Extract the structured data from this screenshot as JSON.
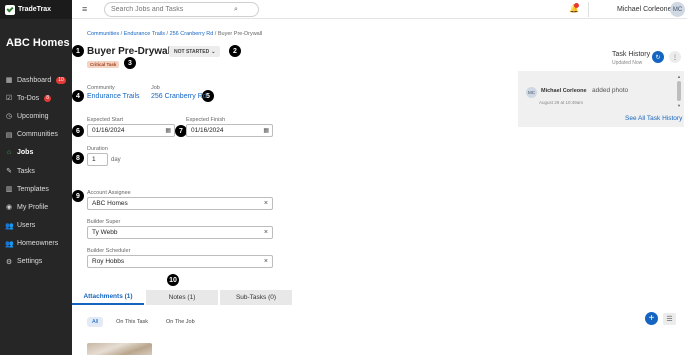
{
  "app": {
    "logo_text": "TradeTrax",
    "org_name": "ABC Homes"
  },
  "sidebar": {
    "items": [
      {
        "label": "Dashboard",
        "icon": "calendar-icon",
        "badge": "10"
      },
      {
        "label": "To-Dos",
        "icon": "checklist-icon",
        "badge": "8"
      },
      {
        "label": "Upcoming",
        "icon": "clock-icon",
        "badge": ""
      },
      {
        "label": "Communities",
        "icon": "map-icon",
        "badge": ""
      },
      {
        "label": "Jobs",
        "icon": "house-icon",
        "badge": "",
        "active": true
      },
      {
        "label": "Tasks",
        "icon": "wrench-icon",
        "badge": ""
      },
      {
        "label": "Templates",
        "icon": "template-icon",
        "badge": ""
      },
      {
        "label": "My Profile",
        "icon": "profile-icon",
        "badge": ""
      },
      {
        "label": "Users",
        "icon": "users-icon",
        "badge": ""
      },
      {
        "label": "Homeowners",
        "icon": "homeowners-icon",
        "badge": ""
      },
      {
        "label": "Settings",
        "icon": "gear-icon",
        "badge": ""
      }
    ]
  },
  "topbar": {
    "search_placeholder": "Search Jobs and Tasks",
    "user_name": "Michael Corleone",
    "avatar_initials": "MC"
  },
  "breadcrumb": {
    "items": [
      "Communities",
      "Endurance Trails",
      "256 Cranberry Rd",
      "Buyer Pre-Drywall"
    ],
    "separator": " / "
  },
  "task": {
    "title": "Buyer Pre-Drywall",
    "status": "NOT STARTED",
    "tag": "Critical Task",
    "community_label": "Community",
    "community_value": "Endurance Trails",
    "job_label": "Job",
    "job_value": "256 Cranberry Rd",
    "expected_start_label": "Expected Start",
    "expected_start_value": "01/16/2024",
    "expected_finish_label": "Expected Finish",
    "expected_finish_value": "01/16/2024",
    "duration_label": "Duration",
    "duration_value": "1",
    "duration_unit": "day",
    "account_assignee_label": "Account Assignee",
    "account_assignee_value": "ABC Homes",
    "builder_super_label": "Builder Super",
    "builder_super_value": "Ty Webb",
    "builder_scheduler_label": "Builder Scheduler",
    "builder_scheduler_value": "Roy Hobbs"
  },
  "markers": [
    "1",
    "2",
    "3",
    "4",
    "5",
    "6",
    "7",
    "8",
    "9",
    "10"
  ],
  "tabs": [
    {
      "label": "Attachments (1)",
      "active": true
    },
    {
      "label": "Notes (1)",
      "active": false
    },
    {
      "label": "Sub-Tasks (0)",
      "active": false
    }
  ],
  "filters": [
    {
      "label": "All",
      "active": true
    },
    {
      "label": "On This Task",
      "active": false
    },
    {
      "label": "On The Job",
      "active": false
    }
  ],
  "history": {
    "title": "Task History",
    "subtitle": "Updated Now",
    "entry_initials": "MC",
    "entry_name": "Michael Corleone",
    "entry_action": "added photo",
    "entry_time": "August 29 at 10:49am",
    "see_all": "See All Task History"
  },
  "colors": {
    "accent": "#1565c0",
    "sidebar_bg": "#262626",
    "active_nav": "#4caf50",
    "badge": "#e53935",
    "critical_tag_bg": "#f3d3c3"
  }
}
